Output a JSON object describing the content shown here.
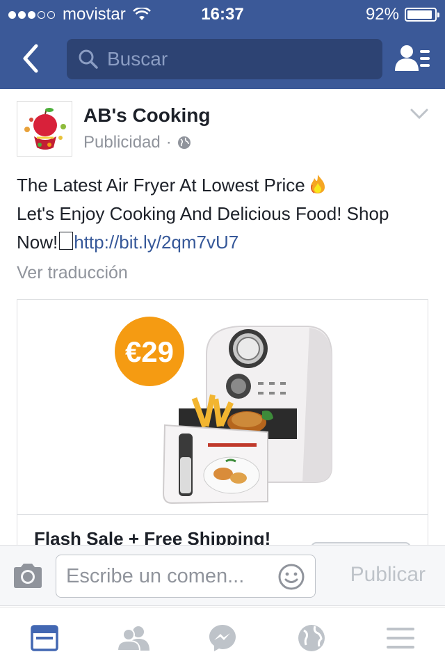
{
  "status_bar": {
    "carrier": "movistar",
    "signal_bars_filled": 3,
    "signal_bars_total": 5,
    "time": "16:37",
    "battery_percent": "92%",
    "battery_level": 0.92
  },
  "nav": {
    "search_placeholder": "Buscar",
    "icons": [
      "back-chevron-icon",
      "search-icon",
      "friend-requests-icon"
    ]
  },
  "post": {
    "page_name": "AB's Cooking",
    "sponsored_label": "Publicidad",
    "separator": "·",
    "text_line1": "The Latest Air Fryer At Lowest Price",
    "text_line2_prefix": "Let's Enjoy Cooking And Delicious Food! Shop Now!",
    "link": "http://bit.ly/2qm7vU7",
    "see_translation": "Ver traducción",
    "ad": {
      "price_badge": "€29",
      "headline": "Flash Sale + Free Shipping!"
    }
  },
  "comment_bar": {
    "placeholder": "Escribe un comen...",
    "publish_label": "Publicar"
  },
  "tab_bar": {
    "active_tab": "news-feed",
    "tabs": [
      "news-feed",
      "friends",
      "messenger",
      "notifications",
      "menu"
    ]
  },
  "colors": {
    "brand_blue": "#3b5998",
    "search_bg": "#2d4373",
    "link_blue": "#365899",
    "muted_gray": "#90949c",
    "active_tab_blue": "#4267b2",
    "inactive_tab_gray": "#bec3c9",
    "price_orange": "#f59b12"
  }
}
